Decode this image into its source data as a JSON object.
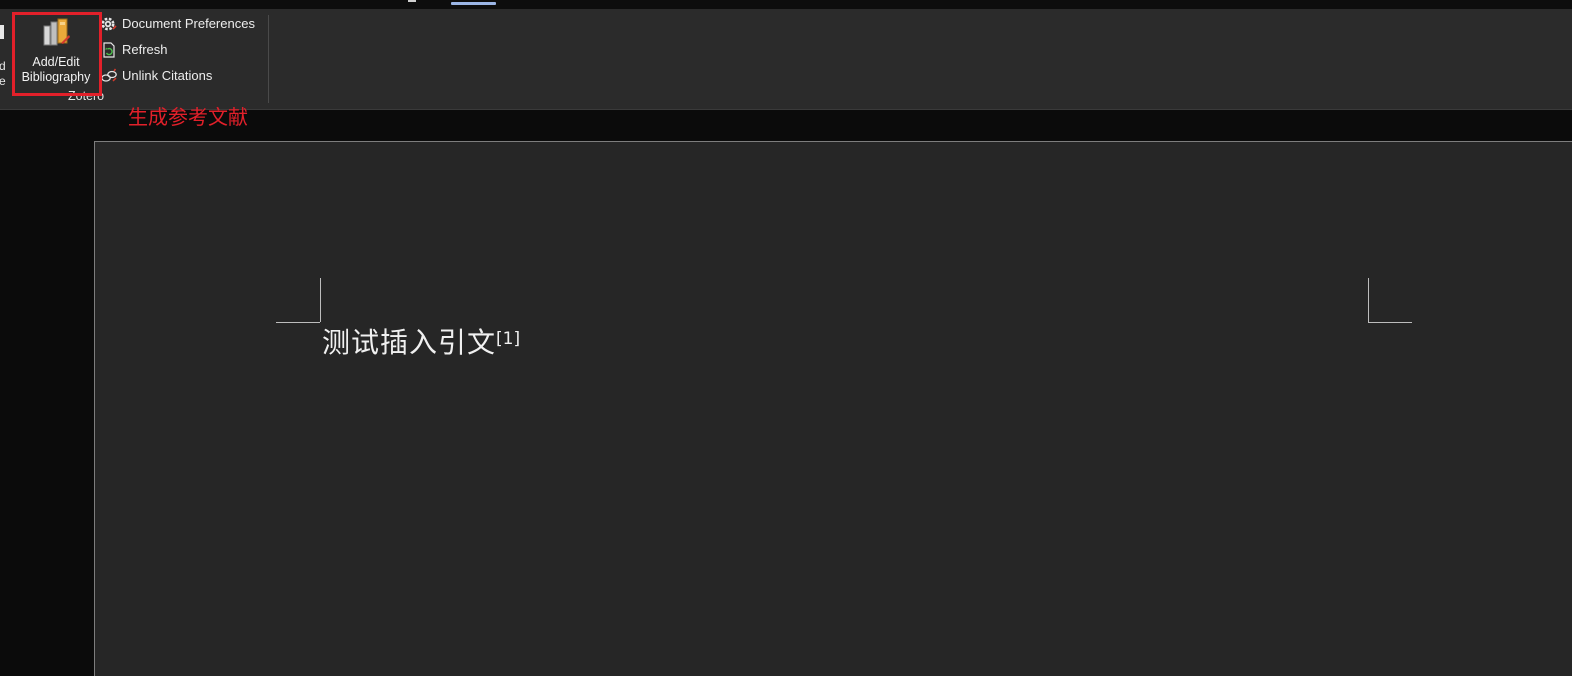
{
  "ribbon": {
    "cut_button": {
      "line1": "d",
      "line2": "e"
    },
    "bibliography_button": {
      "label": "Add/Edit Bibliography",
      "line1": "Add/Edit",
      "line2": "Bibliography",
      "icon": "bibliography-icon"
    },
    "commands": [
      {
        "label": "Document Preferences",
        "icon": "gear-icon"
      },
      {
        "label": "Refresh",
        "icon": "refresh-icon"
      },
      {
        "label": "Unlink Citations",
        "icon": "unlink-icon"
      }
    ],
    "group_label": "Zotero"
  },
  "annotation": {
    "text": "生成参考文献",
    "color": "#e2202a"
  },
  "document": {
    "body_text": "测试插入引文",
    "citation": "[1]"
  },
  "colors": {
    "ribbon_bg": "#2b2b2b",
    "page_bg": "#262626",
    "highlight": "#e2202a"
  }
}
